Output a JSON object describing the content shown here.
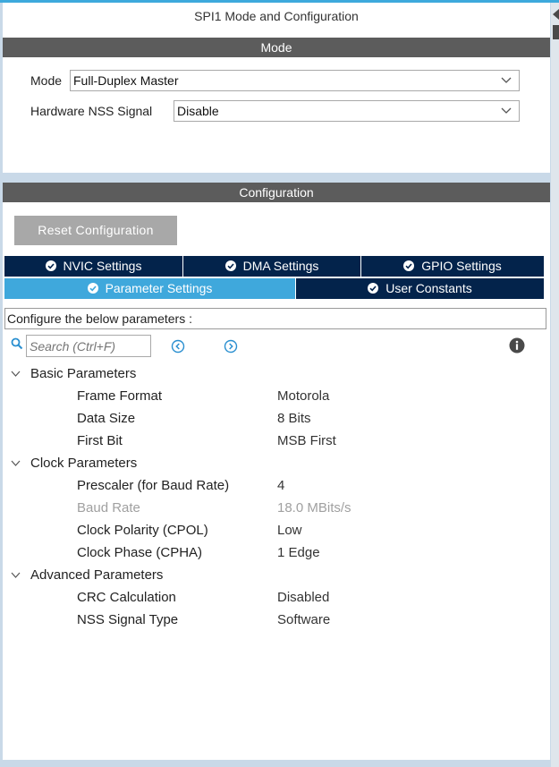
{
  "mode_panel": {
    "title": "SPI1 Mode and Configuration",
    "section_label": "Mode",
    "fields": [
      {
        "label": "Mode",
        "value": "Full-Duplex Master"
      },
      {
        "label": "Hardware NSS Signal",
        "value": "Disable"
      }
    ]
  },
  "config_panel": {
    "section_label": "Configuration",
    "reset_button": "Reset Configuration",
    "tabs_row1": [
      {
        "label": "NVIC Settings"
      },
      {
        "label": "DMA Settings"
      },
      {
        "label": "GPIO Settings"
      }
    ],
    "tabs_row2": [
      {
        "label": "Parameter Settings",
        "active": true
      },
      {
        "label": "User Constants"
      }
    ],
    "instruction": "Configure the below parameters :",
    "search": {
      "placeholder": "Search (Ctrl+F)"
    },
    "groups": [
      {
        "label": "Basic Parameters",
        "params": [
          {
            "name": "Frame Format",
            "value": "Motorola"
          },
          {
            "name": "Data Size",
            "value": "8 Bits"
          },
          {
            "name": "First Bit",
            "value": "MSB First"
          }
        ]
      },
      {
        "label": "Clock Parameters",
        "params": [
          {
            "name": "Prescaler (for Baud Rate)",
            "value": "4"
          },
          {
            "name": "Baud Rate",
            "value": "18.0 MBits/s",
            "disabled": true
          },
          {
            "name": "Clock Polarity (CPOL)",
            "value": "Low"
          },
          {
            "name": "Clock Phase (CPHA)",
            "value": "1 Edge"
          }
        ]
      },
      {
        "label": "Advanced Parameters",
        "params": [
          {
            "name": "CRC Calculation",
            "value": "Disabled"
          },
          {
            "name": "NSS Signal Type",
            "value": "Software"
          }
        ]
      }
    ]
  },
  "colors": {
    "accent": "#3fa8dc",
    "tab_dark": "#03234b",
    "section_bar": "#5c5c5c",
    "button_gray": "#a8a8a8",
    "check_green": "#2e9a3d"
  },
  "icons": {
    "search": "search-icon",
    "prev": "chevron-left-circle-icon",
    "next": "chevron-right-circle-icon",
    "info": "info-icon",
    "check": "check-circle-icon",
    "collapse": "collapse-arrow-icon"
  }
}
